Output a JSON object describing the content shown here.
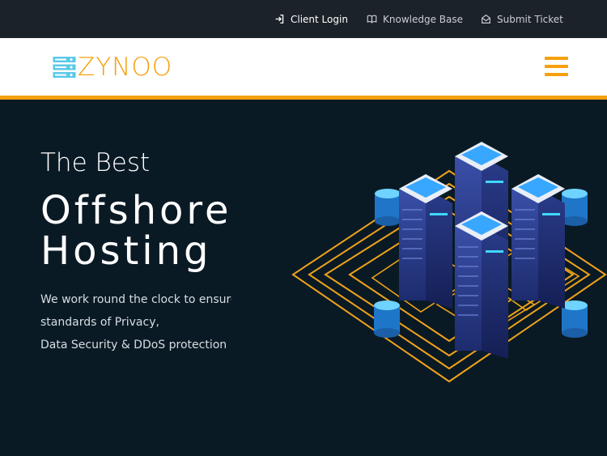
{
  "topbar": {
    "links": [
      {
        "label": "Client Login",
        "icon": "login-icon"
      },
      {
        "label": "Knowledge Base",
        "icon": "book-icon"
      },
      {
        "label": "Submit Ticket",
        "icon": "envelope-open-icon"
      }
    ]
  },
  "brand": {
    "name": "ZYNOO",
    "logo_icon": "server-stack-icon",
    "accent_color": "#f5a00f",
    "logo_mark_color": "#5ac8e8"
  },
  "nav": {
    "menu_icon": "hamburger-icon"
  },
  "hero": {
    "kicker": "The Best",
    "headline_line1": "Offshore",
    "headline_line2": "Hosting",
    "desc_line1": "We work round the clock to ensure",
    "desc_line2": "standards of Privacy,",
    "desc_line3": "Data Security & DDoS protection",
    "background_color": "#0a1a25",
    "illustration_icon": "isometric-datacenter-icon"
  }
}
